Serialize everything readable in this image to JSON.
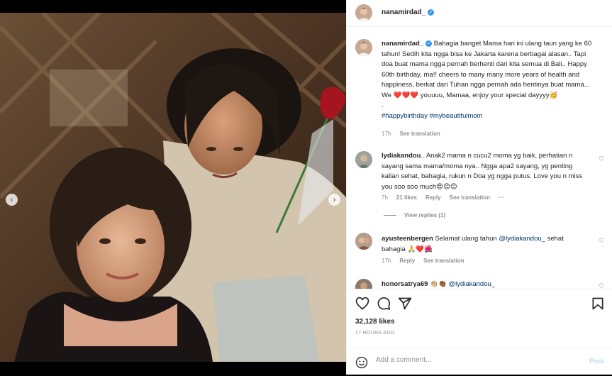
{
  "post": {
    "username": "nanamirdad_",
    "verified_mark": "✓"
  },
  "caption": {
    "username": "nanamirdad_",
    "text_before_hearts": "Bahagia banget Mama hari ini ulang taun yang ke 60 tahun! Sedih kita ngga bisa ke Jakarta karena berbagai alasan.. Tapi doa buat mama ngga pernah berhenti dari kita semua di Bali.. Happy 60th birthday, ma!! cheers to many many more years of health and happiness, berkat dari Tuhan ngga pernah ada hentinya buat mama... We",
    "hearts": "❤️❤️❤️",
    "text_after_hearts": "youuuu, Mamaa, enjoy your special dayyyy🥳",
    "dot": ".",
    "hashtags": "#happybirthday #mybeautifulmom",
    "time": "17h",
    "see_translation": "See translation"
  },
  "comments": [
    {
      "username": "lydiakandou_",
      "text": "Anak2 mama n cucu2 moma yg baik, perhatian n sayang sama mama/moma nya.. Ngga apa2 sayang, yg penting kalian sehat, bahagia, rukun n Doa yg ngga putus. Love you n miss you soo soo much😍😊😊",
      "time": "7h",
      "likes": "21 likes",
      "reply": "Reply",
      "see_translation": "See translation",
      "more": "···",
      "view_replies": "View replies (1)"
    },
    {
      "username": "ayusteenbergen",
      "text_before": "Selamat ulang tahun",
      "mention": "@lydiakandou_",
      "text_after": "sehat bahagia 🙏❤️🌺",
      "time": "17h",
      "reply": "Reply",
      "see_translation": "See translation"
    },
    {
      "username": "honorsatrya69",
      "text_before": "👏🏼👏🏾",
      "mention": "@lydiakandou_"
    }
  ],
  "stats": {
    "likes": "32,128 likes",
    "ago": "17 HOURS AGO"
  },
  "compose": {
    "placeholder": "Add a comment...",
    "post_label": "Post"
  },
  "carousel": {
    "prev": "‹",
    "next": "›",
    "dot_count": 5,
    "active_dot": 3
  },
  "colors": {
    "link": "#00376b",
    "verified": "#3897f0",
    "muted": "#8e8e8e",
    "heart_red": "#ed4956",
    "post_disabled": "#b2dffc"
  },
  "icons": [
    "heart-icon",
    "comment-icon",
    "share-icon",
    "bookmark-icon",
    "emoji-icon",
    "verified-icon",
    "chevron-left-icon",
    "chevron-right-icon"
  ]
}
